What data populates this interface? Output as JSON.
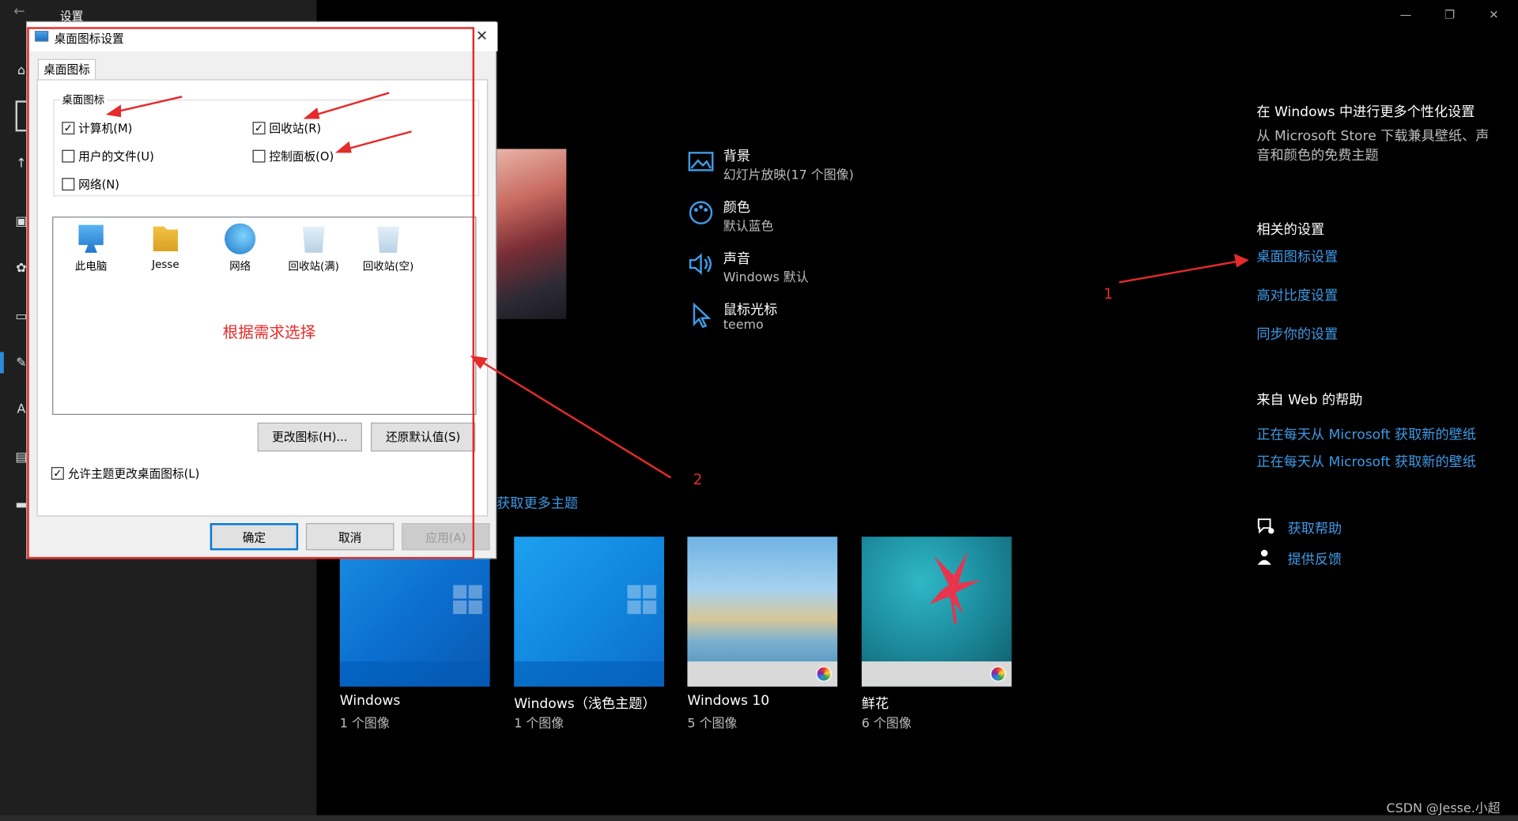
{
  "window": {
    "title": "设置",
    "back_icon": "back-arrow-icon"
  },
  "sidebar": {
    "icons": [
      "home-icon",
      "search-box-icon",
      "upload-icon",
      "image-icon",
      "palette-icon",
      "monitor-icon",
      "edit-icon",
      "font-icon",
      "start-icon",
      "taskbar-icon"
    ]
  },
  "main": {
    "settings": [
      {
        "icon": "picture-icon",
        "title": "背景",
        "subtitle": "幻灯片放映(17 个图像)"
      },
      {
        "icon": "palette-icon",
        "title": "颜色",
        "subtitle": "默认蓝色"
      },
      {
        "icon": "speaker-icon",
        "title": "声音",
        "subtitle": "Windows 默认"
      },
      {
        "icon": "cursor-icon",
        "title": "鼠标光标",
        "subtitle": "teemo"
      }
    ],
    "get_more_themes": "获取更多主题",
    "themes": [
      {
        "name": "Windows",
        "count": "1 个图像"
      },
      {
        "name": "Windows（浅色主题）",
        "count": "1 个图像"
      },
      {
        "name": "Windows 10",
        "count": "5 个图像"
      },
      {
        "name": "鲜花",
        "count": "6 个图像"
      }
    ]
  },
  "rail": {
    "personalize_title": "在 Windows 中进行更多个性化设置",
    "personalize_desc": "从 Microsoft Store 下载兼具壁纸、声音和颜色的免费主题",
    "related_title": "相关的设置",
    "related_links": [
      "桌面图标设置",
      "高对比度设置",
      "同步你的设置"
    ],
    "web_help_title": "来自 Web 的帮助",
    "web_links": [
      "正在每天从 Microsoft 获取新的壁纸",
      "正在每天从 Microsoft 获取新的壁纸"
    ],
    "get_help": "获取帮助",
    "feedback": "提供反馈"
  },
  "dialog": {
    "title": "桌面图标设置",
    "tab": "桌面图标",
    "group_label": "桌面图标",
    "checkboxes": [
      {
        "label": "计算机(M)",
        "checked": true
      },
      {
        "label": "回收站(R)",
        "checked": true
      },
      {
        "label": "用户的文件(U)",
        "checked": false
      },
      {
        "label": "控制面板(O)",
        "checked": false
      },
      {
        "label": "网络(N)",
        "checked": false
      }
    ],
    "icons": [
      {
        "label": "此电脑",
        "icon": "this-pc-icon"
      },
      {
        "label": "Jesse",
        "icon": "user-folder-icon"
      },
      {
        "label": "网络",
        "icon": "network-icon"
      },
      {
        "label": "回收站(满)",
        "icon": "recycle-bin-full-icon"
      },
      {
        "label": "回收站(空)",
        "icon": "recycle-bin-empty-icon"
      }
    ],
    "change_icon_button": "更改图标(H)...",
    "restore_default_button": "还原默认值(S)",
    "allow_themes": {
      "label": "允许主题更改桌面图标(L)",
      "checked": true
    },
    "ok": "确定",
    "cancel": "取消",
    "apply": "应用(A)"
  },
  "annotations": {
    "hint": "根据需求选择",
    "label_1": "1",
    "label_2": "2"
  },
  "watermark": "CSDN @Jesse.小超",
  "colors": {
    "accent": "#3f9ae6",
    "annotation": "#e52b2b",
    "sidebar_bg": "#1f1f1f"
  }
}
